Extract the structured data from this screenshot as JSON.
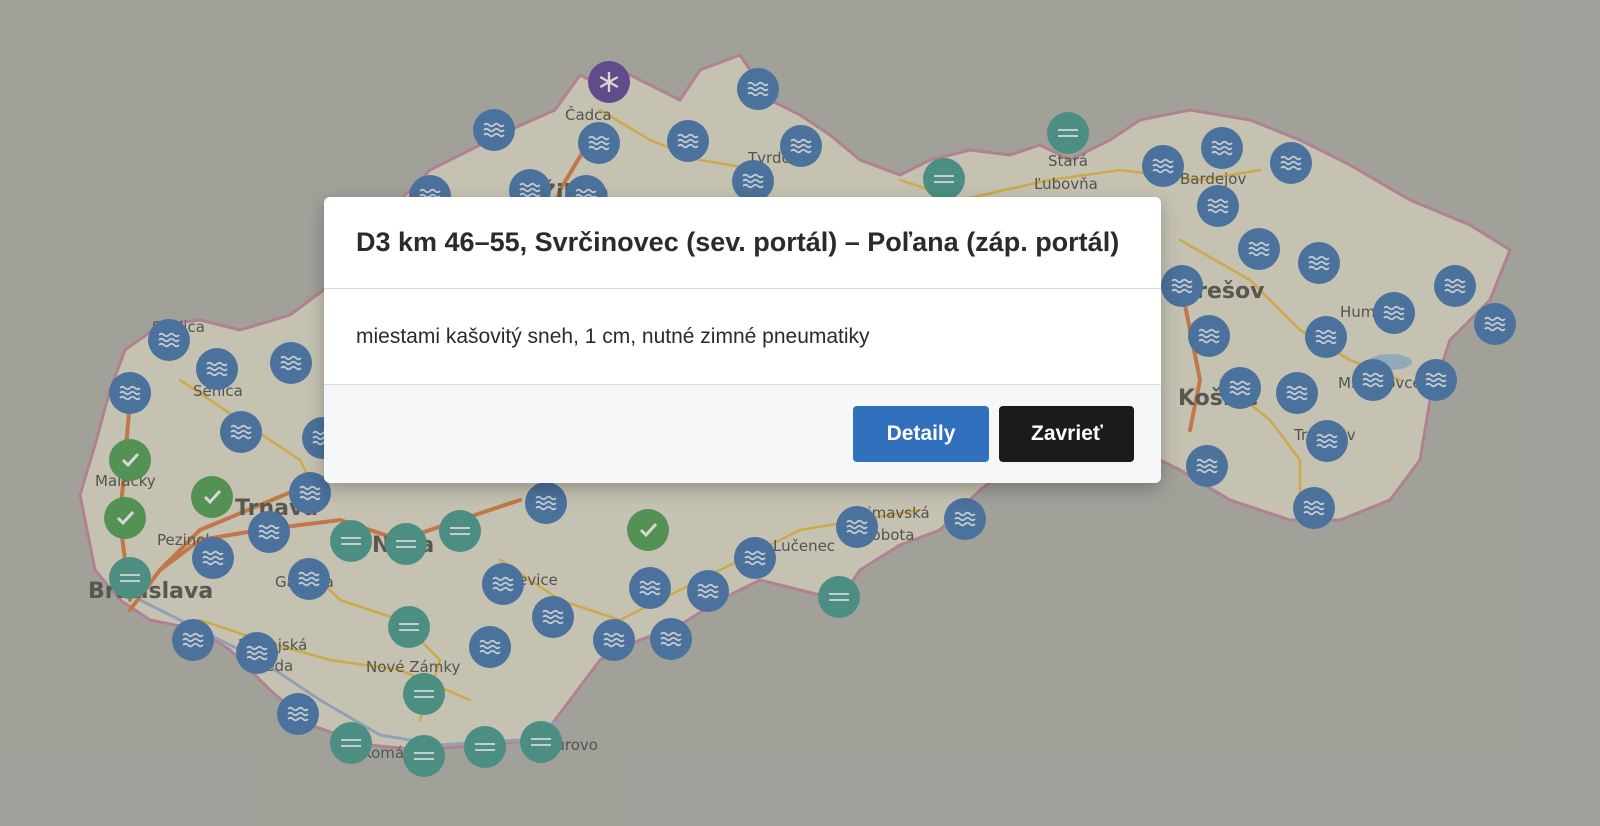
{
  "modal": {
    "title": "D3 km 46–55, Svrčinovec (sev. portál) – Poľana (záp. portál)",
    "description": "miestami kašovitý sneh, 1 cm, nutné zimné pneumatiky",
    "detail_button": "Detaily",
    "close_button": "Zavrieť"
  },
  "map": {
    "cities": [
      "Čadca",
      "Tvrdošín",
      "Stará",
      "Ľubovňa",
      "Bardejov",
      "Prešov",
      "Humenné",
      "Michalovce",
      "Košice",
      "Trebišov",
      "Skalica",
      "Senica",
      "Malacky",
      "Trnava",
      "Pezinok",
      "Bratislava",
      "Galanta",
      "Dunajská",
      "Streda",
      "Nitra",
      "Levice",
      "Nové Zámky",
      "Komárno",
      "Štúrovo",
      "Lučenec",
      "Rimavská",
      "Sobota",
      "Žilina"
    ],
    "marker_types": {
      "wet": {
        "color": "#3e74b0",
        "icon": "waves-icon"
      },
      "fog": {
        "color": "#3f9a8c",
        "icon": "equals-icon"
      },
      "ok": {
        "color": "#4a9e4e",
        "icon": "check-icon"
      },
      "snow": {
        "color": "#5b3f98",
        "icon": "snowflake-icon"
      }
    }
  }
}
